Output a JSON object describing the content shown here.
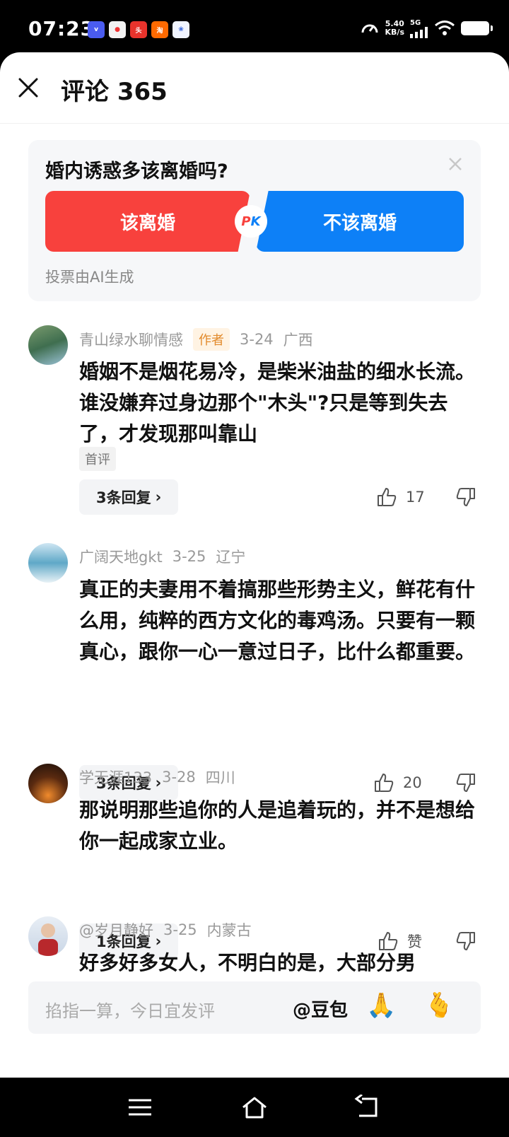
{
  "status": {
    "time": "07:23",
    "speed_value": "5.40",
    "speed_unit": "KB/s",
    "network": "5G",
    "notification_icons": [
      "vivo-icon",
      "news-app-icon",
      "toutiao-icon",
      "taobao-icon",
      "baidu-icon"
    ]
  },
  "header": {
    "title": "评论 365",
    "close_icon": "close-icon"
  },
  "poll": {
    "question": "婚内诱惑多该离婚吗?",
    "option_left": "该离婚",
    "option_right": "不该离婚",
    "pk_p": "P",
    "pk_k": "K",
    "note": "投票由AI生成",
    "colors": {
      "left": "#f8413d",
      "right": "#0d80f7"
    }
  },
  "comments": [
    {
      "username": "青山绿水聊情感",
      "author_tag": "作者",
      "date": "3-24",
      "location": "广西",
      "text": "婚姻不是烟花易冷，是柴米油盐的细水长流。谁没嫌弃过身边那个\"木头\"?只是等到失去了，才发现那叫靠山",
      "badge": "首评",
      "replies": "3条回复",
      "likes": "17"
    },
    {
      "username": "广阔天地gkt",
      "date": "3-25",
      "location": "辽宁",
      "text": "真正的夫妻用不着搞那些形势主义，鲜花有什么用，纯粹的西方文化的毒鸡汤。只要有一颗真心，跟你一心一意过日子，比什么都重要。",
      "replies": "3条回复",
      "likes": "20"
    },
    {
      "username": "学无涯133",
      "date": "3-28",
      "location": "四川",
      "text": "那说明那些追你的人是追着玩的，并不是想给你一起成家立业。",
      "replies": "1条回复",
      "likes": "赞"
    },
    {
      "username": "@岁月静好",
      "date": "3-25",
      "location": "内蒙古",
      "text": "好多好多女人，不明白的是，大部分男"
    }
  ],
  "input": {
    "placeholder": "掐指一算，今日宜发评",
    "mention": "@豆包",
    "emoji_1": "🙏",
    "emoji_2": "🫰"
  },
  "navbar": {
    "icons": [
      "menu-icon",
      "home-icon",
      "back-icon"
    ]
  }
}
